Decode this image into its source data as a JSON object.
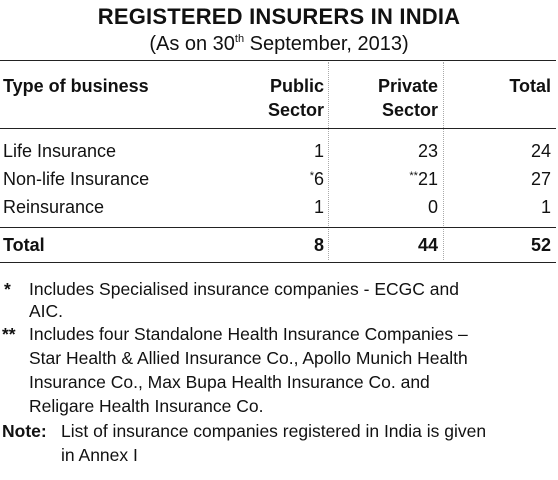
{
  "title": "REGISTERED INSURERS IN INDIA",
  "subtitle": {
    "prefix": "(As on 30",
    "sup": "th",
    "suffix": " September, 2013)"
  },
  "table": {
    "headers": {
      "type_of_business": "Type of business",
      "public_line1": "Public",
      "public_line2": "Sector",
      "private_line1": "Private",
      "private_line2": "Sector",
      "total": "Total"
    },
    "rows": [
      {
        "label": "Life Insurance",
        "public_mark": "",
        "public": "1",
        "private_mark": "",
        "private": "23",
        "total": "24"
      },
      {
        "label": "Non-life Insurance",
        "public_mark": "*",
        "public": "6",
        "private_mark": "**",
        "private": "21",
        "total": "27"
      },
      {
        "label": "Reinsurance",
        "public_mark": "",
        "public": "1",
        "private_mark": "",
        "private": "0",
        "total": "1"
      }
    ],
    "total_row": {
      "label": "Total",
      "public": "8",
      "private": "44",
      "total": "52"
    }
  },
  "footnotes": {
    "single_mark": "*",
    "single_line1": "Includes Specialised insurance companies - ECGC and",
    "single_line2": "AIC.",
    "double_mark": "**",
    "double_line1": "Includes four Standalone Health Insurance Companies –",
    "double_line2": "Star Health & Allied Insurance Co., Apollo Munich Health",
    "double_line3": "Insurance Co., Max Bupa Health Insurance Co. and",
    "double_line4": "Religare Health Insurance Co.",
    "note_label": "Note:",
    "note_line1": "List of insurance companies registered in India is given",
    "note_line2": "in Annex I"
  }
}
